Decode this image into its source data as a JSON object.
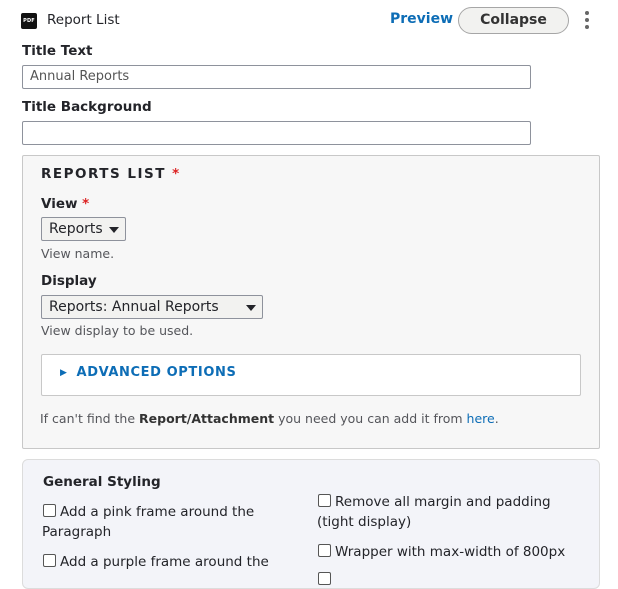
{
  "header": {
    "icon_text": "PDF",
    "title": "Report List",
    "preview_label": "Preview",
    "collapse_label": "Collapse"
  },
  "title_text": {
    "label": "Title Text",
    "value": "Annual Reports"
  },
  "title_background": {
    "label": "Title Background",
    "value": ""
  },
  "reports_list": {
    "legend": "REPORTS LIST",
    "required_mark": "*",
    "view": {
      "label": "View",
      "required_mark": "*",
      "selected": "Reports",
      "description": "View name."
    },
    "display": {
      "label": "Display",
      "selected": "Reports: Annual Reports",
      "description": "View display to be used."
    },
    "advanced_options": {
      "label": "ADVANCED OPTIONS",
      "expanded": false
    },
    "help": {
      "prefix": "If can't find the ",
      "bold": "Report/Attachment",
      "middle": " you need you can add it from ",
      "link": "here",
      "suffix": "."
    }
  },
  "general_styling": {
    "title": "General Styling",
    "options": [
      {
        "label_line1": "Add a pink frame around the",
        "label_line2": "Paragraph",
        "checked": false
      },
      {
        "label_line1": "Add a purple frame around the",
        "label_line2": "",
        "checked": false
      },
      {
        "label_line1": "Remove all margin and padding",
        "label_line2": "(tight display)",
        "checked": false
      },
      {
        "label_line1": "Wrapper with max-width of 800px",
        "label_line2": "",
        "checked": false
      }
    ]
  },
  "colors": {
    "link": "#0d6db6",
    "required": "#dc2323",
    "fieldset_bg": "#f7f7f7",
    "styling_bg": "#f3f4f9"
  }
}
